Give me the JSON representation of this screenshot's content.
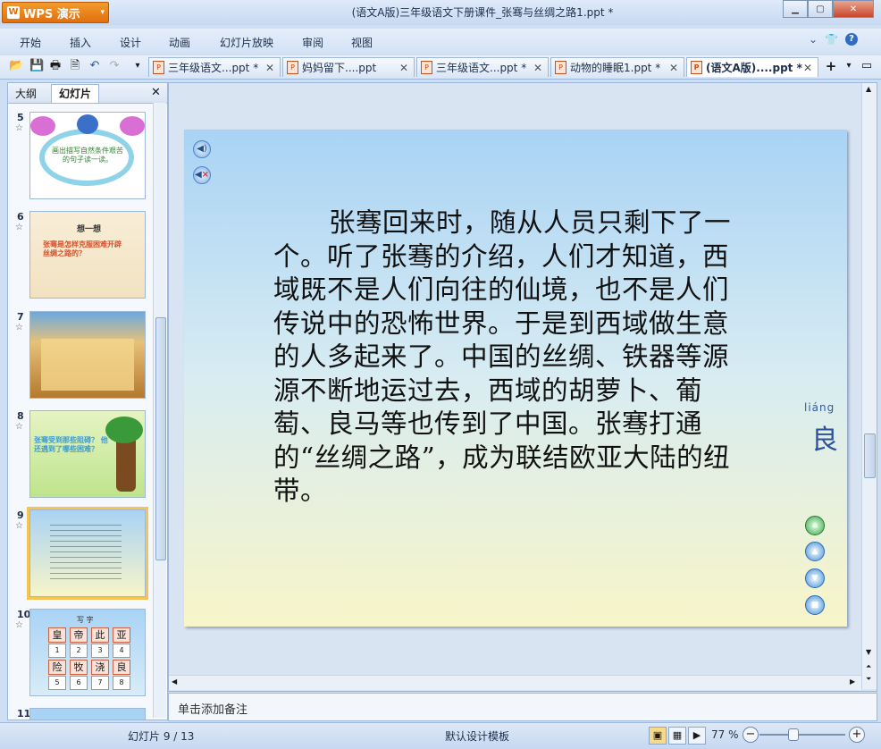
{
  "app": {
    "menu_button": "WPS 演示",
    "window_title": "(语文A版)三年级语文下册课件_张骞与丝绸之路1.ppt *"
  },
  "menu": [
    "开始",
    "插入",
    "设计",
    "动画",
    "幻灯片放映",
    "审阅",
    "视图"
  ],
  "doc_tabs": [
    {
      "label": "三年级语文...ppt *"
    },
    {
      "label": "妈妈留下....ppt"
    },
    {
      "label": "三年级语文...ppt *"
    },
    {
      "label": "动物的睡眠1.ppt *"
    },
    {
      "label": "(语文A版)....ppt *"
    }
  ],
  "side_panel": {
    "tab_outline": "大纲",
    "tab_slides": "幻灯片",
    "slides": [
      {
        "num": "5",
        "text": "画出描写自然条件艰苦的句子读一读。"
      },
      {
        "num": "6",
        "title": "想一想",
        "text": "张骞是怎样克服困难开辟丝绸之路的？"
      },
      {
        "num": "7",
        "text": ""
      },
      {
        "num": "8",
        "text": "张骞受到那些阻碍？ 他还遇到了哪些困难？"
      },
      {
        "num": "9",
        "text": ""
      },
      {
        "num": "10",
        "title": "写 字",
        "chars_top": [
          "皇",
          "帝",
          "此",
          "亚"
        ],
        "nums_top": [
          "1",
          "2",
          "3",
          "4"
        ],
        "chars_bottom": [
          "险",
          "牧",
          "浇",
          "良"
        ],
        "nums_bottom": [
          "5",
          "6",
          "7",
          "8"
        ]
      },
      {
        "num": "11",
        "text": ""
      }
    ]
  },
  "slide": {
    "body": "张骞回来时，随从人员只剩下了一个。听了张骞的介绍，人们才知道，西域既不是人们向往的仙境，也不是人们传说中的恐怖世界。于是到西域做生意的人多起来了。中国的丝绸、铁器等源源不断地运过去，西域的胡萝卜、葡萄、良马等也传到了中国。张骞打通的“丝绸之路”，成为联结欧亚大陆的纽带。",
    "pinyin": "liáng",
    "hanzi": "良"
  },
  "notes_placeholder": "单击添加备注",
  "status": {
    "slide_counter": "幻灯片 9 / 13",
    "template": "默认设计模板",
    "zoom": "77 %"
  }
}
